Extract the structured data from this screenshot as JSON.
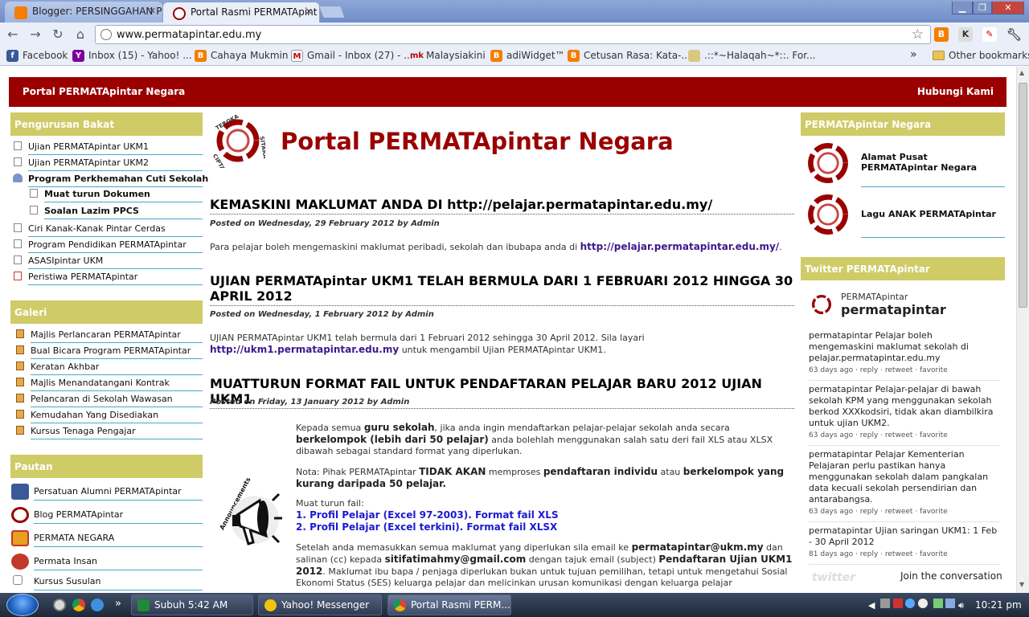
{
  "browser": {
    "tabs": [
      {
        "title": "Blogger: PERSINGGAHAN P",
        "active": false
      },
      {
        "title": "Portal Rasmi PERMATApint",
        "active": true
      }
    ],
    "address": "www.permatapintar.edu.my",
    "bookmarks": [
      {
        "label": "Facebook",
        "icon": "facebook-icon"
      },
      {
        "label": "Inbox (15) - Yahoo! ...",
        "icon": "yahoo-icon"
      },
      {
        "label": "Cahaya Mukmin",
        "icon": "blogger-icon"
      },
      {
        "label": "Gmail - Inbox (27) - ...",
        "icon": "gmail-icon"
      },
      {
        "label": "Malaysiakini",
        "icon": "malaysiakini-icon"
      },
      {
        "label": "adiWidget™",
        "icon": "blogger-icon"
      },
      {
        "label": "Cetusan Rasa: Kata-...",
        "icon": "blogger-icon"
      },
      {
        "label": ".::*~Halaqah~*::. For...",
        "icon": "halaqah-icon"
      }
    ],
    "more_bookmarks": "»",
    "other_bookmarks": "Other bookmarks"
  },
  "site": {
    "header_left": "Portal PERMATApintar Negara",
    "header_right": "Hubungi Kami",
    "title": "Portal PERMATApintar Negara",
    "logo_text": [
      "TEROKA",
      "CIPTA",
      "SITARA"
    ]
  },
  "sidebar": {
    "pengurusan": {
      "heading": "Pengurusan Bakat",
      "items": [
        "Ujian PERMATApintar UKM1",
        "Ujian PERMATApintar UKM2",
        "Program Perkhemahan Cuti Sekolah",
        "Muat turun Dokumen",
        "Soalan Lazim PPCS",
        "Ciri Kanak-Kanak Pintar Cerdas",
        "Program Pendidikan PERMATApintar",
        "ASASIpintar UKM",
        "Peristiwa PERMATApintar"
      ]
    },
    "galeri": {
      "heading": "Galeri",
      "items": [
        "Majlis Perlancaran PERMATApintar",
        "Bual Bicara Program PERMATApintar",
        "Keratan Akhbar",
        "Majlis Menandatangani Kontrak",
        "Pelancaran di Sekolah Wawasan",
        "Kemudahan Yang Disediakan",
        "Kursus Tenaga Pengajar"
      ]
    },
    "pautan": {
      "heading": "Pautan",
      "items": [
        "Persatuan Alumni PERMATApintar",
        "Blog PERMATApintar",
        "PERMATA NEGARA",
        "Permata Insan",
        "Kursus Susulan"
      ]
    }
  },
  "posts": [
    {
      "title": "KEMASKINI MAKLUMAT ANDA DI http://pelajar.permatapintar.edu.my/",
      "meta": "Posted on Wednesday, 29 February 2012 by Admin",
      "body": "Para pelajar boleh mengemaskini maklumat peribadi, sekolah dan ibubapa anda di ",
      "link": "http://pelajar.permatapintar.edu.my/",
      "after": "."
    },
    {
      "title": "UJIAN PERMATApintar UKM1 TELAH BERMULA DARI 1 FEBRUARI 2012 HINGGA 30 APRIL 2012",
      "meta": "Posted on Wednesday, 1 February 2012 by Admin",
      "body": "UJIAN PERMATApintar UKM1 telah bermula dari 1 Februari 2012 sehingga 30 April 2012. Sila layari",
      "link": "http://ukm1.permatapintar.edu.my",
      "after": " untuk mengambil Ujian PERMATApintar UKM1."
    },
    {
      "title": "MUATTURUN FORMAT FAIL UNTUK PENDAFTARAN PELAJAR BARU 2012 UJIAN UKM1",
      "meta": "Posted on Friday, 13 January 2012 by Admin",
      "p1_a": "Kepada semua ",
      "p1_b": "guru sekolah",
      "p1_c": ", jika anda ingin mendaftarkan pelajar-pelajar sekolah anda secara ",
      "p1_d": "berkelompok (lebih dari 50 pelajar)",
      "p1_e": " anda bolehlah menggunakan salah satu deri fail XLS atau XLSX dibawah sebagai standard format yang diperlukan.",
      "p2_a": "Nota: Pihak PERMATApintar ",
      "p2_b": "TIDAK AKAN",
      "p2_c": " memproses ",
      "p2_d": "pendaftaran individu",
      "p2_e": " atau ",
      "p2_f": "berkelompok yang kurang daripada 50 pelajar.",
      "p3": "Muat turun fail:",
      "dl1": "1. Profil Pelajar (Excel 97-2003). Format fail XLS",
      "dl2": "2. Profil Pelajar (Excel terkini). Format fail XLSX",
      "p4_a": "Setelah anda memasukkan semua maklumat yang diperlukan sila email ke ",
      "p4_b": "permatapintar@ukm.my",
      "p4_c": " dan salinan (cc) kepada ",
      "p4_d": "sitifatimahmy@gmail.com",
      "p4_e": " dengan tajuk email (subject) ",
      "p4_f": "Pendaftaran Ujian UKM1 2012",
      "p4_g": ". Maklumat ibu bapa / penjaga diperlukan bukan untuk tujuan pemilihan, tetapi untuk mengetahui Sosial Ekonomi Status (SES) keluarga pelajar dan melicinkan urusan komunikasi dengan keluarga pelajar",
      "announce_label": "Announcements"
    }
  ],
  "right": {
    "negara_heading": "PERMATApintar Negara",
    "negara_items": [
      "Alamat Pusat PERMATApintar Negara",
      "Lagu ANAK PERMATApintar"
    ],
    "twitter_heading": "Twitter PERMATApintar",
    "twitter_name": "PERMATApintar",
    "twitter_handle": "permatapintar",
    "tweets": [
      {
        "text": "permatapintar Pelajar boleh mengemaskini maklumat sekolah di pelajar.permatapintar.edu.my",
        "meta": "63 days ago · reply · retweet · favorite"
      },
      {
        "text": "permatapintar Pelajar-pelajar di bawah sekolah KPM yang menggunakan sekolah berkod XXXkodsiri, tidak akan diambilkira untuk ujian UKM2.",
        "meta": "63 days ago · reply · retweet · favorite"
      },
      {
        "text": "permatapintar Pelajar Kementerian Pelajaran perlu pastikan hanya menggunakan sekolah dalam pangkalan data kecuali sekolah persendirian dan antarabangsa.",
        "meta": "63 days ago · reply · retweet · favorite"
      },
      {
        "text": "permatapintar Ujian saringan UKM1: 1 Feb - 30 April 2012",
        "meta": "81 days ago · reply · retweet · favorite"
      }
    ],
    "join": "Join the conversation"
  },
  "taskbar": {
    "tasks": [
      {
        "label": "Subuh 5:42 AM",
        "active": false
      },
      {
        "label": "Yahoo! Messenger",
        "active": false
      },
      {
        "label": "Portal Rasmi PERM...",
        "active": true
      }
    ],
    "clock": "10:21 pm",
    "more": "»"
  },
  "colors": {
    "brand_red": "#9a0000",
    "sidebar_olive": "#cfcb67",
    "divider_blue": "#48a9c5"
  }
}
